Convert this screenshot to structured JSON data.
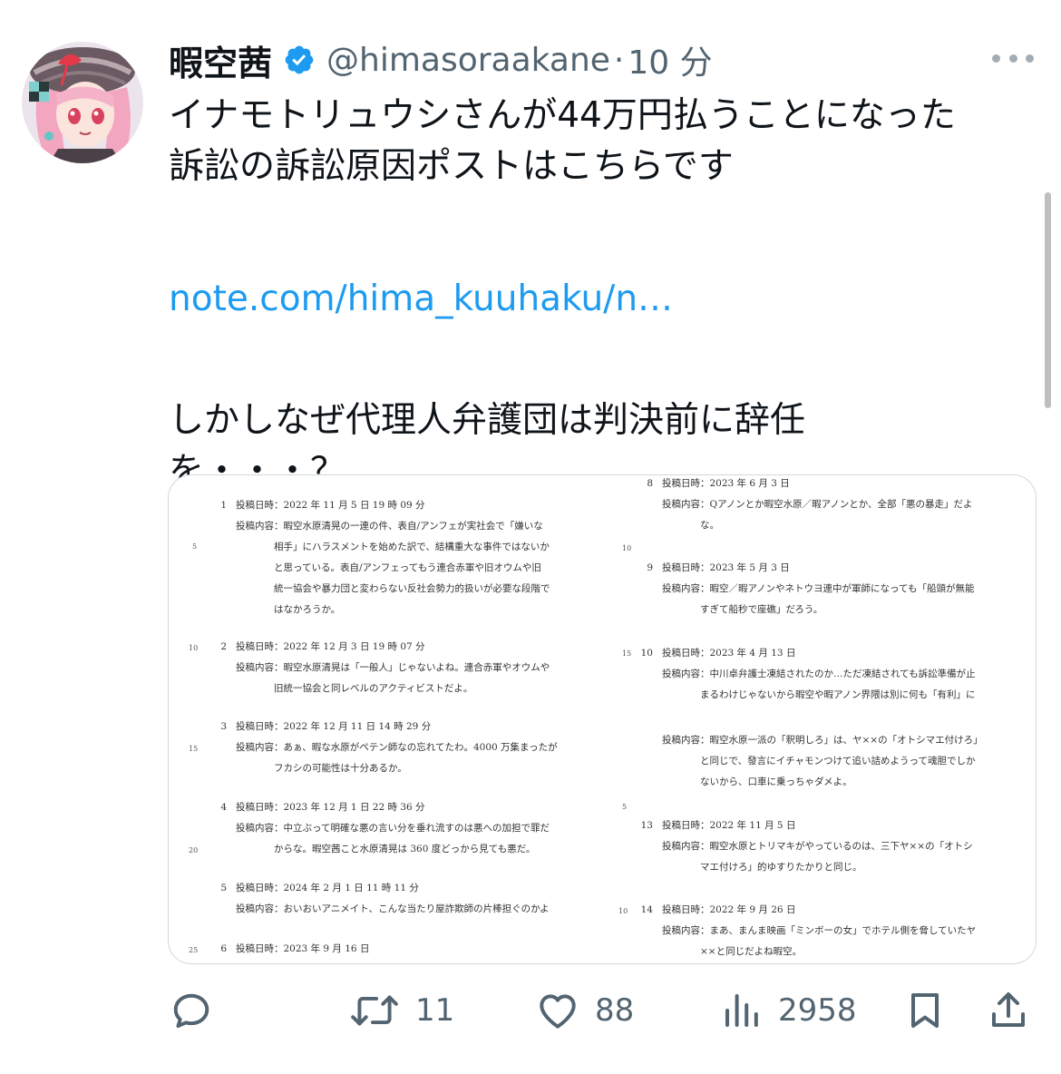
{
  "tweet": {
    "author_name": "暇空茜",
    "handle": "@himasoraakane",
    "separator": "·",
    "time": "10 分",
    "text_lines": [
      "イナモトリュウシさんが44万円払うことになった",
      "訴訟の訴訟原因ポストはこちらです",
      "",
      "note.com/hima_kuuhaku/n…",
      "",
      "しかしなぜ代理人弁護団は判決前に辞任",
      "を・・・？"
    ],
    "link_text": "note.com/hima_kuuhaku/n…"
  },
  "document": {
    "left": [
      {
        "num": "1",
        "date": "投稿日時：2022 年 11 月 5 日 19 時 09 分",
        "content": [
          "投稿内容：暇空水原清晃の一連の件、表自/アンフェが実社会で「嫌いな",
          "相手」にハラスメントを始めた訳で、結構重大な事件ではないか",
          "と思っている。表自/アンフェってもう連合赤軍や旧オウムや旧",
          "統一協会や暴力団と変わらない反社会勢力的扱いが必要な段階で",
          "はなかろうか。"
        ]
      },
      {
        "num": "2",
        "date": "投稿日時：2022 年 12 月 3 日 19 時 07 分",
        "content": [
          "投稿内容：暇空水原清晃は「一般人」じゃないよね。連合赤軍やオウムや",
          "旧統一協会と同レベルのアクティビストだよ。"
        ]
      },
      {
        "num": "3",
        "date": "投稿日時：2022 年 12 月 11 日 14 時 29 分",
        "content": [
          "投稿内容：あぁ、暇な水原がペテン師なの忘れてたわ。4000 万集まったが",
          "フカシの可能性は十分あるか。"
        ]
      },
      {
        "num": "4",
        "date": "投稿日時：2023 年 12 月 1 日 22 時 36 分",
        "content": [
          "投稿内容：中立ぶって明確な悪の言い分を垂れ流すのは悪への加担で罪だ",
          "からな。暇空茜こと水原清晃は 360 度どっから見ても悪だ。"
        ]
      },
      {
        "num": "5",
        "date": "投稿日時：2024 年 2 月 1 日 11 時 11 分",
        "content": [
          "投稿内容：おいおいアニメイト、こんな当たり屋詐欺師の片棒担ぐのかよ"
        ]
      },
      {
        "num": "6",
        "date": "投稿日時：2023 年 9 月 16 日",
        "content": []
      }
    ],
    "left_linenos": [
      "5",
      "10",
      "15",
      "20",
      "25"
    ],
    "right": [
      {
        "num": "8",
        "date": "投稿日時：2023 年 6 月 3 日",
        "content": [
          "投稿内容：Qアノンとか暇空水原／暇アノンとか、全部「悪の暴走」だよ",
          "な。"
        ]
      },
      {
        "num": "9",
        "date": "投稿日時：2023 年 5 月 3 日",
        "content": [
          "投稿内容：暇空／暇アノンやネトウヨ連中が軍師になっても「船頭が無能",
          "すぎて船秒で座礁」だろう。"
        ]
      },
      {
        "num": "10",
        "date": "投稿日時：2023 年 4 月 13 日",
        "content": [
          "投稿内容：中川卓弁護士凍結されたのか…ただ凍結されても訴訟準備が止",
          "まるわけじゃないから暇空や暇アノン界隈は別に何も「有利」に"
        ]
      },
      {
        "num": "",
        "date": "投稿内容：暇空水原一派の「釈明しろ」は、ヤ××の「オトシマエ付けろ」",
        "content": [
          "と同じで、發言にイチャモンつけて追い詰めようって魂胆でしか",
          "ないから、口車に乗っちゃダメよ。"
        ]
      },
      {
        "num": "13",
        "date": "投稿日時：2022 年 11 月 5 日",
        "content": [
          "投稿内容：暇空水原とトリマキがやっているのは、三下ヤ××の「オトシ",
          "マエ付けろ」的ゆすりたかりと同じ。"
        ]
      },
      {
        "num": "14",
        "date": "投稿日時：2022 年 9 月 26 日",
        "content": [
          "投稿内容：まあ、まんま映画「ミンボーの女」でホテル側を脅していたヤ",
          "××と同じだよね暇空。"
        ]
      }
    ],
    "right_linenos": [
      "10",
      "15",
      "5",
      "10"
    ]
  },
  "actions": {
    "reply_count": "",
    "retweet_count": "11",
    "like_count": "88",
    "views_count": "2958"
  },
  "colors": {
    "text": "#0f1419",
    "secondary": "#536471",
    "link": "#1d9bf0",
    "verified": "#1d9bf0",
    "border": "#cfd9de"
  }
}
